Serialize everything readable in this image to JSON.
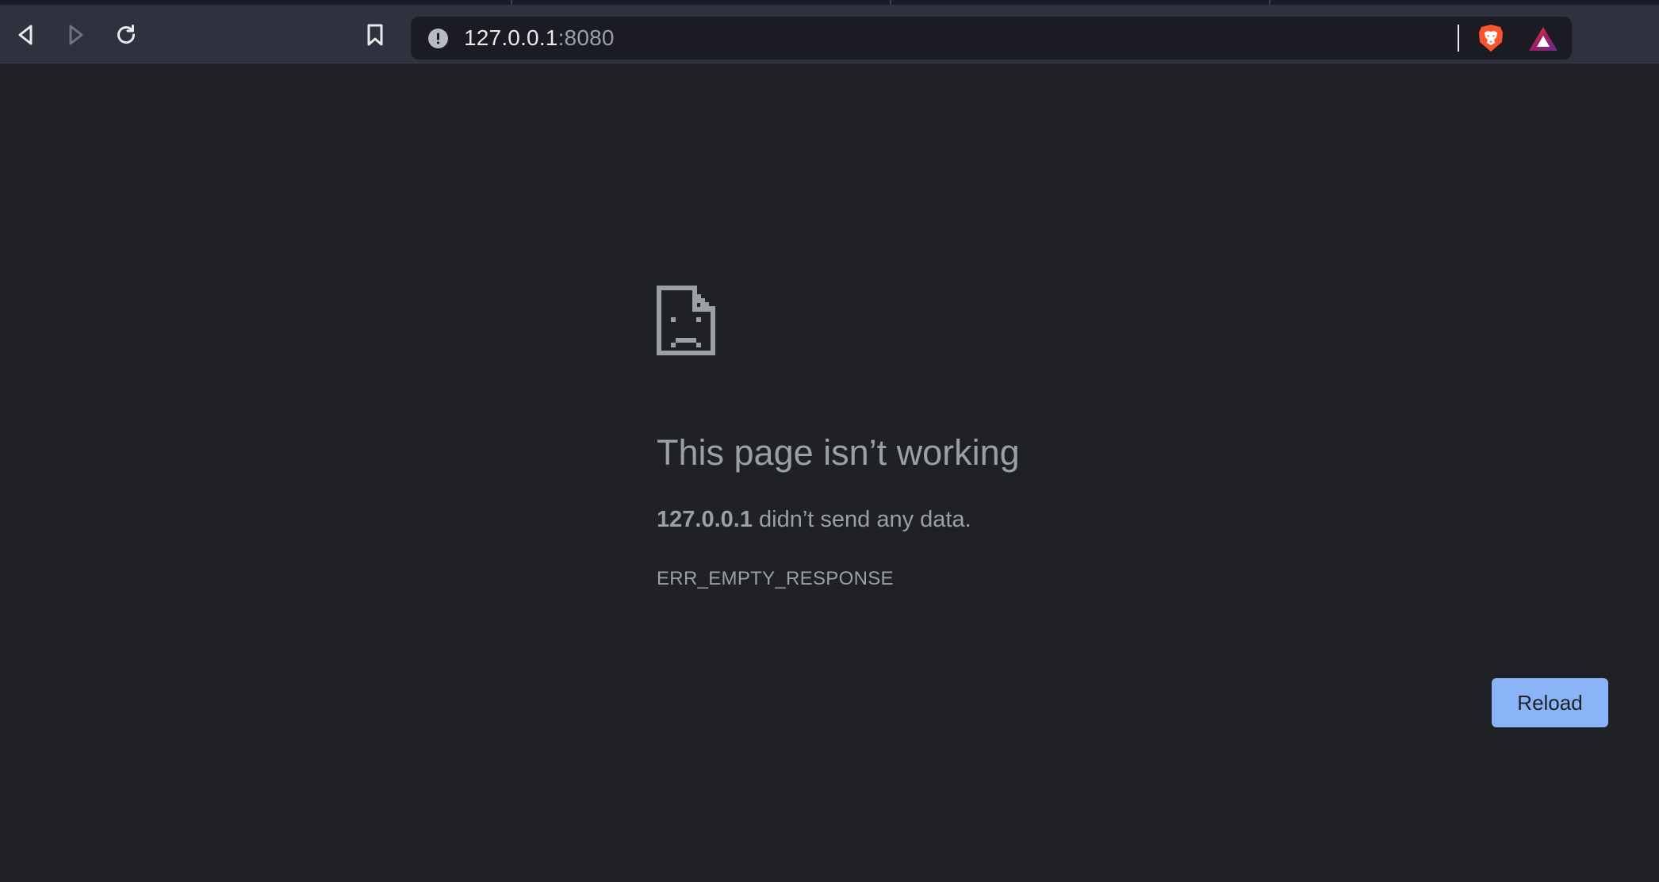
{
  "browser": {
    "url_host": "127.0.0.1",
    "url_port": ":8080",
    "icons": {
      "back": "back-icon",
      "forward": "forward-icon",
      "reload": "reload-icon",
      "bookmark": "bookmark-icon",
      "site_info": "info-icon",
      "shields": "brave-shields-icon",
      "rewards": "brave-rewards-icon"
    }
  },
  "error_page": {
    "title": "This page isn’t working",
    "host": "127.0.0.1",
    "message": " didn’t send any data.",
    "error_code": "ERR_EMPTY_RESPONSE",
    "reload_label": "Reload"
  },
  "colors": {
    "page_background": "#202124",
    "toolbar_background": "#2f313f",
    "omnibox_background": "#1b1c23",
    "text_secondary": "#9aa0a6",
    "reload_button": "#8ab4f8",
    "brave_orange": "#fb542b"
  }
}
